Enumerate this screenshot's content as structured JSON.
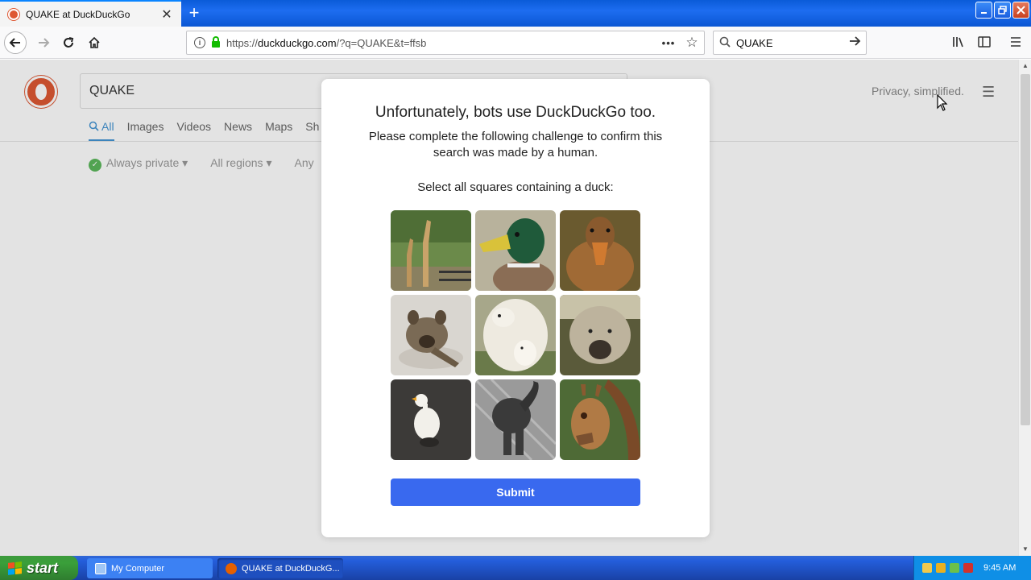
{
  "browser": {
    "tab_title": "QUAKE at DuckDuckGo",
    "new_tab_symbol": "+",
    "close_tab_symbol": "✕",
    "url_prefix": "https://",
    "url_domain": "duckduckgo.com",
    "url_rest": "/?q=QUAKE&t=ffsb",
    "search_value": "QUAKE",
    "page_actions_symbol": "•••",
    "colors": {
      "titlebar": "#0b56d3",
      "lock": "#12bc00"
    }
  },
  "page": {
    "query": "QUAKE",
    "privacy_text": "Privacy, simplified.",
    "tabs": [
      "All",
      "Images",
      "Videos",
      "News",
      "Maps",
      "Sh"
    ],
    "filters": [
      "Always private",
      "All regions",
      "Any"
    ]
  },
  "modal": {
    "title": "Unfortunately, bots use DuckDuckGo too.",
    "subtitle": "Please complete the following challenge to confirm this search was made by a human.",
    "instruction": "Select all squares containing a duck:",
    "submit_label": "Submit",
    "tiles": [
      {
        "subject": "giraffes"
      },
      {
        "subject": "mallard duck"
      },
      {
        "subject": "hen duck"
      },
      {
        "subject": "hyena cub"
      },
      {
        "subject": "polar bears"
      },
      {
        "subject": "boar"
      },
      {
        "subject": "white duck"
      },
      {
        "subject": "elephant"
      },
      {
        "subject": "giraffe"
      }
    ],
    "colors": {
      "submit": "#3969ef"
    }
  },
  "taskbar": {
    "start_label": "start",
    "tasks": [
      "My Computer",
      "QUAKE at DuckDuckG..."
    ],
    "clock": "9:45 AM"
  }
}
